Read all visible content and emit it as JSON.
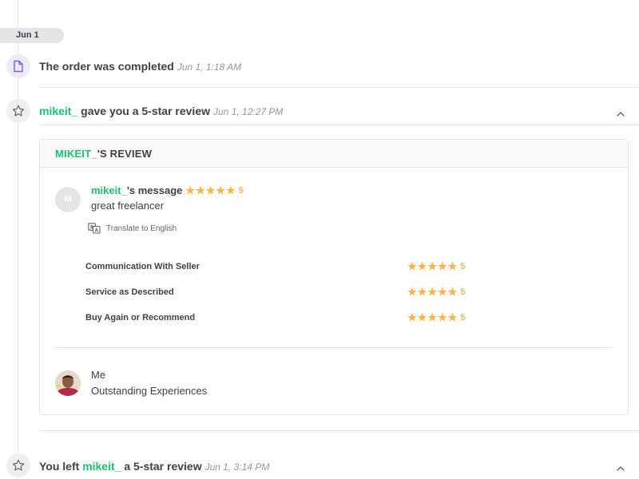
{
  "date_pill": "Jun 1",
  "events": [
    {
      "icon": "document-icon",
      "text": "The order was completed",
      "time": "Jun 1, 1:18 AM"
    },
    {
      "icon": "star-icon",
      "user": "mikeit_",
      "text": " gave you a 5-star review",
      "time": "Jun 1, 12:27 PM"
    },
    {
      "icon": "star-icon",
      "prefix": "You left ",
      "user": "mikeit_",
      "text": " a 5-star review",
      "time": "Jun 1, 3:14 PM"
    }
  ],
  "review": {
    "header_user": "MIKEIT_",
    "header_suffix": "'S REVIEW",
    "avatar_initial": "M",
    "message_user": "mikeit_",
    "message_suffix": "'s message",
    "rating": "5",
    "message": "great freelancer",
    "translate_label": "Translate to English",
    "criteria": [
      {
        "label": "Communication With Seller",
        "rating": "5"
      },
      {
        "label": "Service as Described",
        "rating": "5"
      },
      {
        "label": "Buy Again or Recommend",
        "rating": "5"
      }
    ],
    "reply_name": "Me",
    "reply_text": "Outstanding Experiences"
  },
  "colors": {
    "accent_green": "#1dbf73",
    "star_gold": "#ffb33e",
    "doc_icon_purple": "#7b5ce0"
  }
}
